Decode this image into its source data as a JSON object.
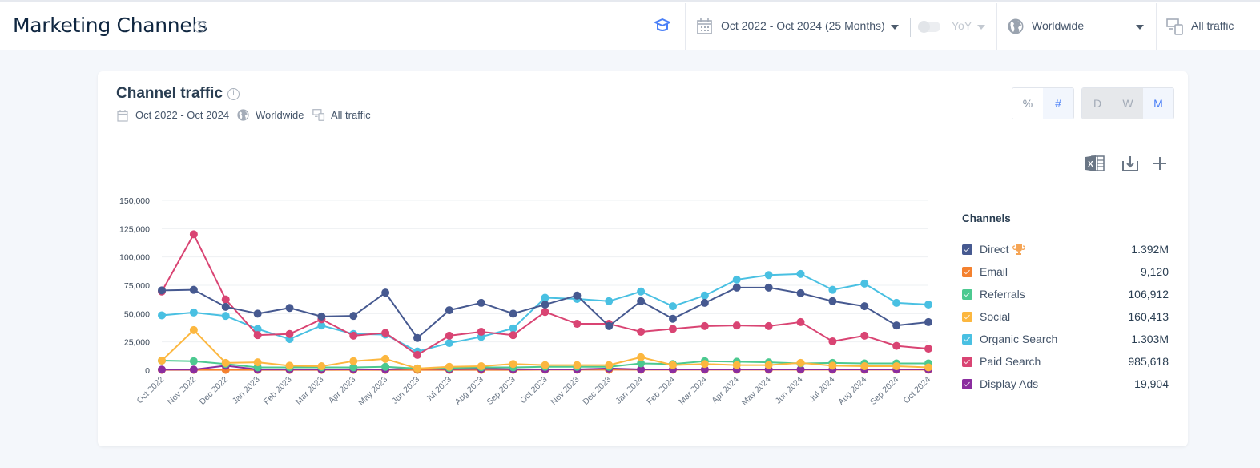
{
  "header": {
    "title": "Marketing Channels",
    "info_icon": "info-icon",
    "learn_icon": "graduation-cap-icon",
    "date_range": "Oct 2022 - Oct 2024 (25 Months)",
    "yoy_label": "YoY",
    "yoy_enabled": false,
    "country": "Worldwide",
    "traffic": "All traffic"
  },
  "card": {
    "title": "Channel traffic",
    "meta": {
      "date_range": "Oct 2022 - Oct 2024",
      "country": "Worldwide",
      "traffic": "All traffic"
    },
    "metric_toggle": [
      {
        "label": "%",
        "active": false
      },
      {
        "label": "#",
        "active": true
      }
    ],
    "granularity_toggle": [
      {
        "label": "D",
        "active": false
      },
      {
        "label": "W",
        "active": false
      },
      {
        "label": "M",
        "active": true
      }
    ],
    "actions": [
      "excel-export-icon",
      "download-icon",
      "add-icon"
    ]
  },
  "legend": {
    "title": "Channels",
    "items": [
      {
        "name": "Direct",
        "value": "1.392M",
        "color": "#465990",
        "top": true
      },
      {
        "name": "Email",
        "value": "9,120",
        "color": "#f4812f"
      },
      {
        "name": "Referrals",
        "value": "106,912",
        "color": "#4cc990"
      },
      {
        "name": "Social",
        "value": "160,413",
        "color": "#fcb73f"
      },
      {
        "name": "Organic Search",
        "value": "1.303M",
        "color": "#49c0e2"
      },
      {
        "name": "Paid Search",
        "value": "985,618",
        "color": "#d94473"
      },
      {
        "name": "Display Ads",
        "value": "19,904",
        "color": "#8b2d9f"
      }
    ]
  },
  "chart_data": {
    "type": "line",
    "title": "Channel traffic",
    "xlabel": "",
    "ylabel": "",
    "ylim": [
      0,
      150000
    ],
    "yticks": [
      0,
      25000,
      50000,
      75000,
      100000,
      125000,
      150000
    ],
    "ytick_labels": [
      "0",
      "25,000",
      "50,000",
      "75,000",
      "100,000",
      "125,000",
      "150,000"
    ],
    "grid": true,
    "legend_position": "right",
    "x": [
      "Oct 2022",
      "Nov 2022",
      "Dec 2022",
      "Jan 2023",
      "Feb 2023",
      "Mar 2023",
      "Apr 2023",
      "May 2023",
      "Jun 2023",
      "Jul 2023",
      "Aug 2023",
      "Sep 2023",
      "Oct 2023",
      "Nov 2023",
      "Dec 2023",
      "Jan 2024",
      "Feb 2024",
      "Mar 2024",
      "Apr 2024",
      "May 2024",
      "Jun 2024",
      "Jul 2024",
      "Aug 2024",
      "Sep 2024",
      "Oct 2024"
    ],
    "series": [
      {
        "name": "Email",
        "color": "#f4812f",
        "values": [
          300,
          300,
          300,
          300,
          300,
          300,
          300,
          300,
          300,
          300,
          300,
          300,
          400,
          400,
          400,
          400,
          400,
          400,
          400,
          400,
          400,
          400,
          400,
          400,
          400
        ]
      },
      {
        "name": "Display Ads",
        "color": "#8b2d9f",
        "values": [
          500,
          500,
          4000,
          600,
          600,
          600,
          800,
          600,
          1500,
          900,
          1200,
          800,
          700,
          700,
          1500,
          700,
          700,
          700,
          700,
          700,
          700,
          700,
          700,
          700,
          700
        ]
      },
      {
        "name": "Referrals",
        "color": "#4cc990",
        "values": [
          8500,
          8000,
          5500,
          2500,
          2500,
          2500,
          2500,
          3000,
          1500,
          2000,
          2500,
          2500,
          3000,
          3000,
          3000,
          6000,
          5500,
          8000,
          7500,
          7000,
          6000,
          6500,
          6000,
          6000,
          6000
        ]
      },
      {
        "name": "Social",
        "color": "#fcb73f",
        "values": [
          8500,
          35500,
          6500,
          7000,
          4000,
          3500,
          8000,
          10000,
          1500,
          3000,
          3500,
          5500,
          4500,
          4500,
          4500,
          11500,
          4500,
          5500,
          4500,
          4500,
          6500,
          4000,
          3500,
          3500,
          2500
        ]
      },
      {
        "name": "Organic Search",
        "color": "#49c0e2",
        "values": [
          48500,
          51000,
          48000,
          36500,
          27500,
          39500,
          32000,
          31500,
          16500,
          24000,
          29500,
          37000,
          64000,
          63000,
          61000,
          69500,
          56500,
          66000,
          80000,
          84000,
          85000,
          71000,
          76500,
          59500,
          58000
        ]
      },
      {
        "name": "Paid Search",
        "color": "#d94473",
        "values": [
          69500,
          120000,
          62500,
          31000,
          32000,
          45000,
          30500,
          33000,
          13500,
          30500,
          34000,
          31000,
          51500,
          41000,
          41000,
          34000,
          36500,
          39000,
          39500,
          39000,
          42500,
          25500,
          30500,
          21500,
          19000
        ]
      },
      {
        "name": "Direct",
        "color": "#465990",
        "values": [
          70500,
          71000,
          56000,
          50000,
          55000,
          47500,
          48000,
          68500,
          28500,
          53000,
          59500,
          50000,
          58000,
          66000,
          39000,
          61000,
          45500,
          59500,
          73000,
          73000,
          68000,
          61000,
          56500,
          39500,
          42500
        ]
      }
    ]
  }
}
